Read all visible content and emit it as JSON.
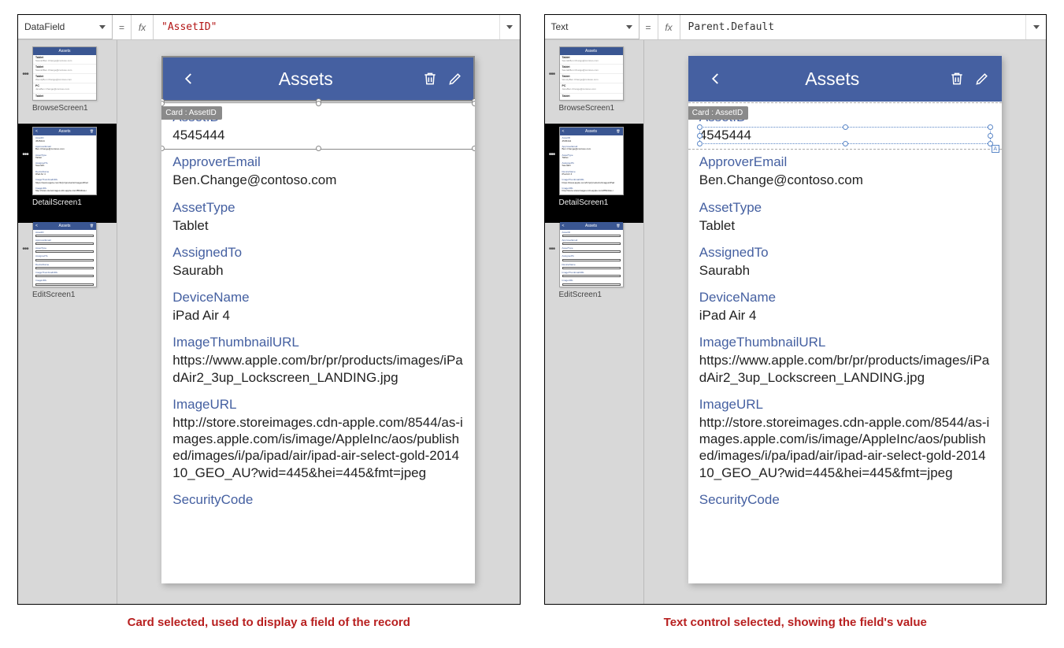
{
  "panels": [
    {
      "propertySelector": "DataField",
      "formulaRaw": "\"AssetID\"",
      "formulaIsString": true,
      "caption": "Card selected, used to display a field of the record",
      "selectionTip": "Card : AssetID",
      "selectionMode": "card"
    },
    {
      "propertySelector": "Text",
      "formulaRaw": "Parent.Default",
      "formulaIsString": false,
      "caption": "Text control selected, showing the field's value",
      "selectionTip": "Card : AssetID",
      "selectionMode": "text"
    }
  ],
  "fx": "fx",
  "eq": "=",
  "tree": {
    "screens": [
      "BrowseScreen1",
      "DetailScreen1",
      "EditScreen1"
    ],
    "browseItems": [
      {
        "title": "Tablet",
        "sub": "Saurab",
        "who": "Ben.Change@contoso.com"
      },
      {
        "title": "Tablet",
        "sub": "Saurab",
        "who": "Ben.Change@contoso.com"
      },
      {
        "title": "Tablet",
        "sub": "Wendy",
        "who": "Ben.Change@contoso.com"
      },
      {
        "title": "PC",
        "sub": "Jane",
        "who": "Ben.Change@contoso.com"
      },
      {
        "title": "Tablet",
        "sub": "",
        "who": ""
      }
    ]
  },
  "app": {
    "title": "Assets",
    "fields": [
      {
        "label": "AssetID",
        "value": "4545444"
      },
      {
        "label": "ApproverEmail",
        "value": "Ben.Change@contoso.com"
      },
      {
        "label": "AssetType",
        "value": "Tablet"
      },
      {
        "label": "AssignedTo",
        "value": "Saurabh"
      },
      {
        "label": "DeviceName",
        "value": "iPad Air 4"
      },
      {
        "label": "ImageThumbnailURL",
        "value": "https://www.apple.com/br/pr/products/images/iPadAir2_3up_Lockscreen_LANDING.jpg"
      },
      {
        "label": "ImageURL",
        "value": "http://store.storeimages.cdn-apple.com/8544/as-images.apple.com/is/image/AppleInc/aos/published/images/i/pa/ipad/air/ipad-air-select-gold-201410_GEO_AU?wid=445&hei=445&fmt=jpeg"
      },
      {
        "label": "SecurityCode",
        "value": ""
      }
    ]
  }
}
